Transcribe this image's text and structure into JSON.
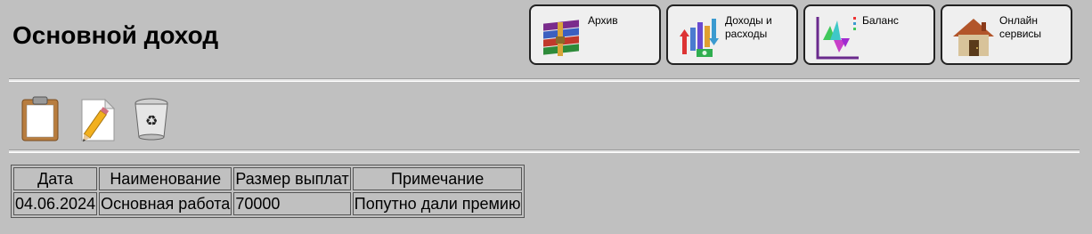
{
  "page_title": "Основной доход",
  "nav": [
    {
      "label": "Архив",
      "icon": "archive-books-icon"
    },
    {
      "label": "Доходы и расходы",
      "icon": "income-expense-icon"
    },
    {
      "label": "Баланс",
      "icon": "balance-chart-icon"
    },
    {
      "label": "Онлайн сервисы",
      "icon": "house-icon"
    }
  ],
  "toolbar": [
    {
      "icon": "clipboard-icon"
    },
    {
      "icon": "edit-document-icon"
    },
    {
      "icon": "recycle-bin-icon"
    }
  ],
  "table": {
    "headers": [
      "Дата",
      "Наименование",
      "Размер выплат",
      "Примечание"
    ],
    "rows": [
      [
        "04.06.2024",
        "Основная работа",
        "70000",
        "Попутно дали премию"
      ]
    ]
  }
}
